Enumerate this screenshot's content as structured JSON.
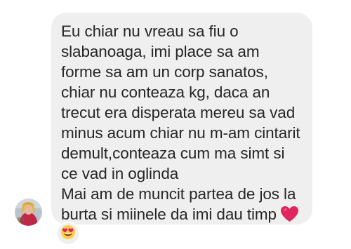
{
  "message": {
    "lines": [
      "Eu chiar nu vreau sa fiu o",
      "slabanoaga, imi place sa am",
      "forme sa am un corp sanatos,",
      "chiar nu conteaza kg, daca an",
      "trecut era disperata mereu sa vad",
      "minus acum chiar nu m-am cintarit",
      "demult,conteaza cum ma simt si",
      "ce vad in oglinda",
      "Mai am de muncit partea de jos la",
      "burta si miinele da imi dau timp"
    ],
    "trailing_emoji": "red-heart-emoji"
  },
  "reaction": {
    "emoji": "heart-eyes-emoji"
  },
  "colors": {
    "bubble": "#efefef",
    "text": "#262626",
    "heart": "#e0245e"
  }
}
